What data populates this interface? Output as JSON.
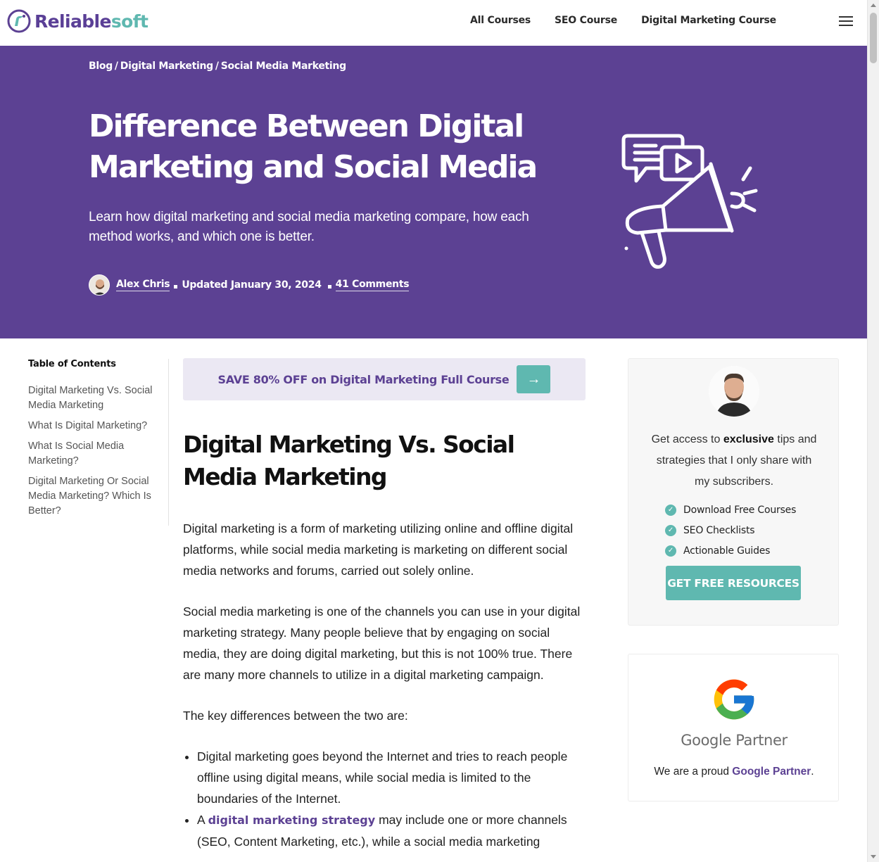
{
  "brand": {
    "logo_main": "Reliable",
    "logo_accent": "soft",
    "colors": {
      "purple": "#5c4193",
      "teal": "#5fb8b0"
    }
  },
  "nav": {
    "items": [
      "All Courses",
      "SEO Course",
      "Digital Marketing Course"
    ],
    "menu_icon": "hamburger-icon"
  },
  "hero": {
    "breadcrumb": [
      "Blog",
      "Digital Marketing",
      "Social Media Marketing"
    ],
    "title": "Difference Between Digital Marketing and Social Media",
    "subtitle": "Learn how digital marketing and social media marketing compare, how each method works, and which one is better.",
    "author": "Alex Chris",
    "updated": "Updated January 30, 2024",
    "comments": "41 Comments",
    "illustration": "megaphone-icon"
  },
  "toc": {
    "title": "Table of Contents",
    "items": [
      "Digital Marketing Vs. Social Media Marketing",
      "What Is Digital Marketing?",
      "What Is Social Media Marketing?",
      "Digital Marketing Or Social Media Marketing? Which Is Better?"
    ]
  },
  "promo": {
    "text": "SAVE 80% OFF on Digital Marketing Full Course",
    "arrow": "→"
  },
  "article": {
    "heading": "Digital Marketing Vs. Social Media Marketing",
    "p1": "Digital marketing is a form of marketing utilizing online and offline digital platforms, while social media marketing is marketing on different social media networks and forums, carried out solely online.",
    "p2": "Social media marketing is one of the channels you can use in your digital marketing strategy. Many people believe that by engaging on social media, they are doing digital marketing, but this is not 100% true. There are many more channels to utilize in a digital marketing campaign.",
    "p3": "The key differences between the two are:",
    "bullet1": "Digital marketing goes beyond the Internet and tries to reach people offline using digital means, while social media is limited to the boundaries of the Internet.",
    "bullet2_prefix": "A",
    "bullet2_link": "digital marketing strategy",
    "bullet2_suffix": "may include one or more channels (SEO, Content Marketing, etc.), while a social media marketing"
  },
  "sidebar": {
    "text_before": "Get access to",
    "text_bold": "exclusive",
    "text_after": "tips and strategies that I only share with my subscribers.",
    "checklist": [
      "Download Free Courses",
      "SEO Checklists",
      "Actionable Guides"
    ],
    "cta": "GET FREE RESOURCES"
  },
  "partner": {
    "name": "Google Partner",
    "text_before": "We are a proud",
    "text_link": "Google Partner",
    "text_after": "."
  }
}
